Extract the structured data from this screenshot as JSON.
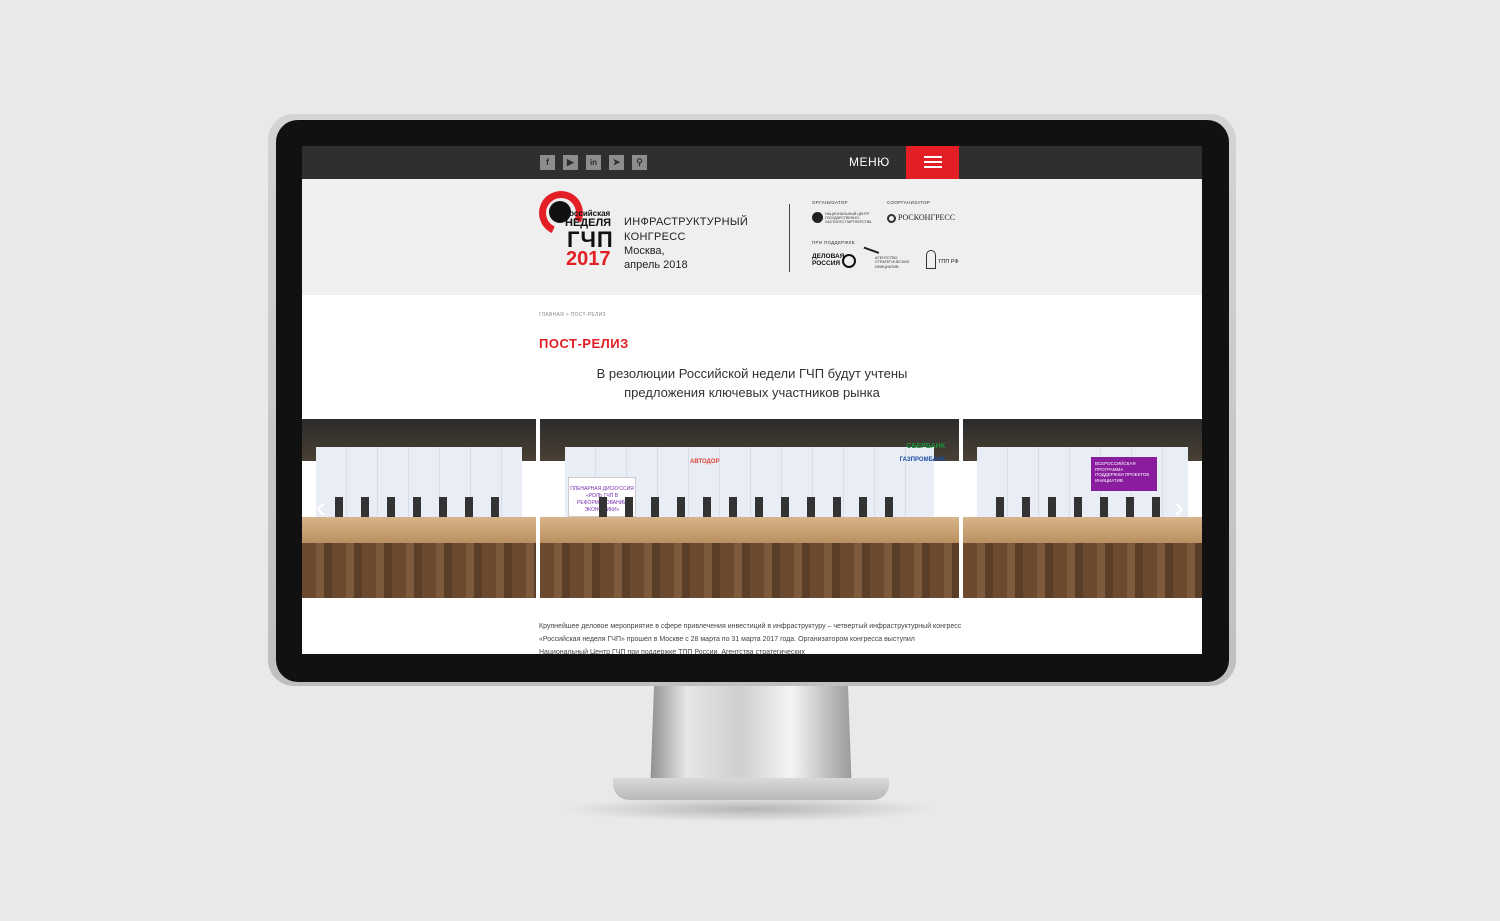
{
  "topbar": {
    "social": [
      {
        "glyph": "f",
        "icon": "facebook-icon"
      },
      {
        "glyph": "▶",
        "icon": "youtube-icon"
      },
      {
        "glyph": "in",
        "icon": "linkedin-icon"
      },
      {
        "glyph": "➤",
        "icon": "telegram-icon"
      },
      {
        "glyph": "⚲",
        "icon": "search-icon"
      }
    ],
    "menu_label": "МЕНЮ",
    "accent_color": "#e31e24"
  },
  "header": {
    "logo": {
      "line1": "Российская",
      "line2": "НЕДЕЛЯ",
      "line3": "ГЧП",
      "line4": "2017"
    },
    "congress": {
      "line1": "ИНФРАСТРУКТУРНЫЙ",
      "line2": "КОНГРЕСС",
      "line3": "Москва,",
      "line4": "апрель 2018"
    },
    "organizer_label": "ОРГАНИЗАТОР",
    "organizer_name": "НАЦИОНАЛЬНЫЙ ЦЕНТР ГОСУДАРСТВЕННО-ЧАСТНОГО ПАРТНЕРСТВА",
    "coorganizer_label": "СООРГАНИЗАТОР",
    "coorganizer_name": "РОСКОНГРЕСС",
    "support_label": "ПРИ ПОДДЕРЖКЕ",
    "support": [
      "ДЕЛОВАЯ РОССИЯ",
      "АГЕНТСТВО СТРАТЕГИЧЕСКИХ ИНИЦИАТИВ",
      "ТПП РФ"
    ]
  },
  "breadcrumb": "ГЛАВНАЯ > ПОСТ-РЕЛИЗ",
  "page_title": "ПОСТ-РЕЛИЗ",
  "lead": {
    "line1": "В резолюции Российской недели ГЧП будут учтены",
    "line2": "предложения ключевых участников рынка"
  },
  "gallery": {
    "slide_b_title": "ПЛЕНАРНАЯ ДИСКУССИЯ «РОЛЬ ГЧП В РЕФОРМИРОВАНИИ ЭКОНОМИКИ»",
    "slide_c_title": "ВСЕРОССИЙСКАЯ ПРОГРАММА ПОДДЕРЖКИ ПРОЕКТОВ ИНИЦИАТИВ",
    "sponsor_1": "СБЕРБАНК",
    "sponsor_2": "ГАЗПРОМБАНК",
    "sponsor_3": "АВТОДОР",
    "prev_glyph": "‹",
    "next_glyph": "›"
  },
  "body_text": "Крупнейшее деловое мероприятие в сфере привлечения инвестиций в инфраструктуру – четвертый инфраструктурный конгресс «Российская неделя ГЧП» прошел в Москве с 28 марта по 31 марта 2017 года. Организатором конгресса выступил Национальный Центр ГЧП при поддержке ТПП России, Агентства стратегических"
}
